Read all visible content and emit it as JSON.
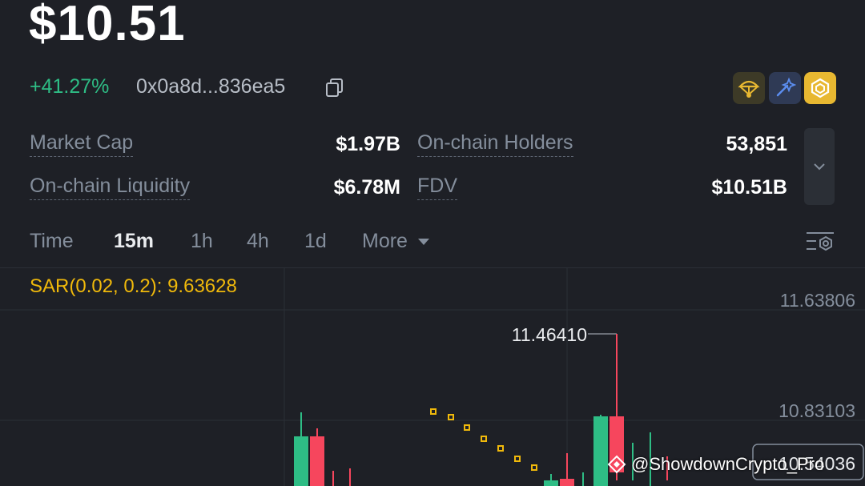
{
  "header": {
    "price": "$10.51",
    "change": "+41.27%",
    "contract": "0x0a8d...836ea5"
  },
  "badges": [
    "parachute-icon",
    "sparkle-icon",
    "bnb-chain-icon"
  ],
  "stats": {
    "market_cap_label": "Market Cap",
    "market_cap_value": "$1.97B",
    "holders_label": "On-chain Holders",
    "holders_value": "53,851",
    "liquidity_label": "On-chain Liquidity",
    "liquidity_value": "$6.78M",
    "fdv_label": "FDV",
    "fdv_value": "$10.51B"
  },
  "timeframes": {
    "time": "Time",
    "m15": "15m",
    "h1": "1h",
    "h4": "4h",
    "d1": "1d",
    "more": "More"
  },
  "chart": {
    "indicator": "SAR(0.02, 0.2): 9.63628",
    "price_labels": [
      "11.63806",
      "10.83103",
      "10.54036"
    ],
    "high_label": "11.46410",
    "colors": {
      "up": "#2ebd85",
      "down": "#f6465d",
      "sar": "#f0b90b",
      "grid": "#2b2f36"
    }
  },
  "watermark": "@ShowdownCrypto_Pro"
}
